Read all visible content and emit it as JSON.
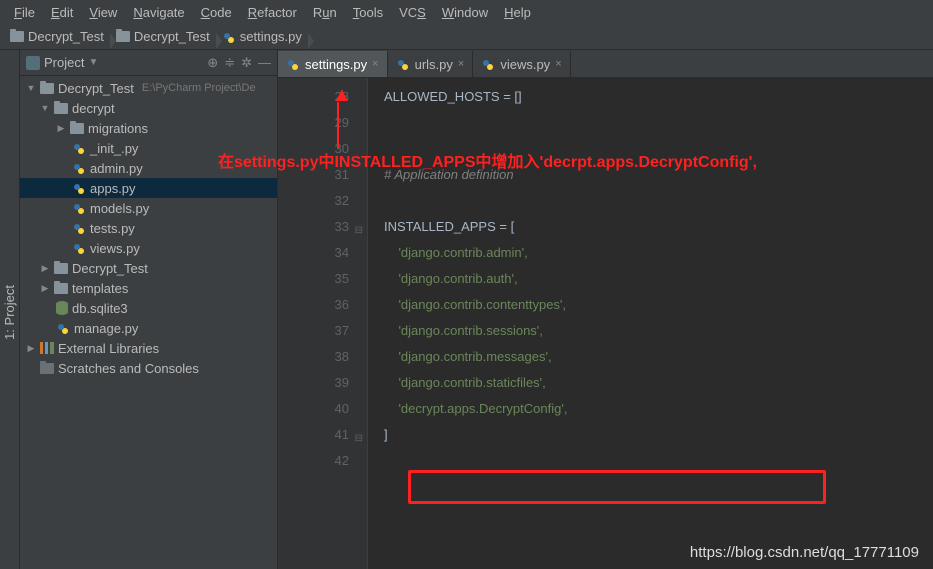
{
  "menu": {
    "file": "File",
    "edit": "Edit",
    "view": "View",
    "navigate": "Navigate",
    "code": "Code",
    "refactor": "Refactor",
    "run": "Run",
    "tools": "Tools",
    "vcs": "VCS",
    "window": "Window",
    "help": "Help"
  },
  "crumbs": {
    "c1": "Decrypt_Test",
    "c2": "Decrypt_Test",
    "c3": "settings.py"
  },
  "project": {
    "title": "Project",
    "root": "Decrypt_Test",
    "rootPath": "E:\\PyCharm Project\\De",
    "app": "decrypt",
    "mig": "migrations",
    "init": "_init_.py",
    "admin": "admin.py",
    "apps": "apps.py",
    "models": "models.py",
    "tests": "tests.py",
    "views": "views.py",
    "proj": "Decrypt_Test",
    "tmpl": "templates",
    "db": "db.sqlite3",
    "manage": "manage.py",
    "ext": "External Libraries",
    "scratch": "Scratches and Consoles"
  },
  "tabs": {
    "t1": "settings.py",
    "t2": "urls.py",
    "t3": "views.py"
  },
  "code": {
    "l28": "ALLOWED_HOSTS = []",
    "l31": "# Application definition",
    "l33": "INSTALLED_APPS = [",
    "l34": "'django.contrib.admin',",
    "l35": "'django.contrib.auth',",
    "l36": "'django.contrib.contenttypes',",
    "l37": "'django.contrib.sessions',",
    "l38": "'django.contrib.messages',",
    "l39": "'django.contrib.staticfiles',",
    "l40": "'decrypt.apps.DecryptConfig',",
    "l41": "]",
    "nums": [
      "28",
      "29",
      "30",
      "31",
      "32",
      "33",
      "34",
      "35",
      "36",
      "37",
      "38",
      "39",
      "40",
      "41",
      "42"
    ]
  },
  "annot": "在settings.py中INSTALLED_APPS中增加入'decrpt.apps.DecryptConfig',",
  "watermark": "https://blog.csdn.net/qq_17771109"
}
